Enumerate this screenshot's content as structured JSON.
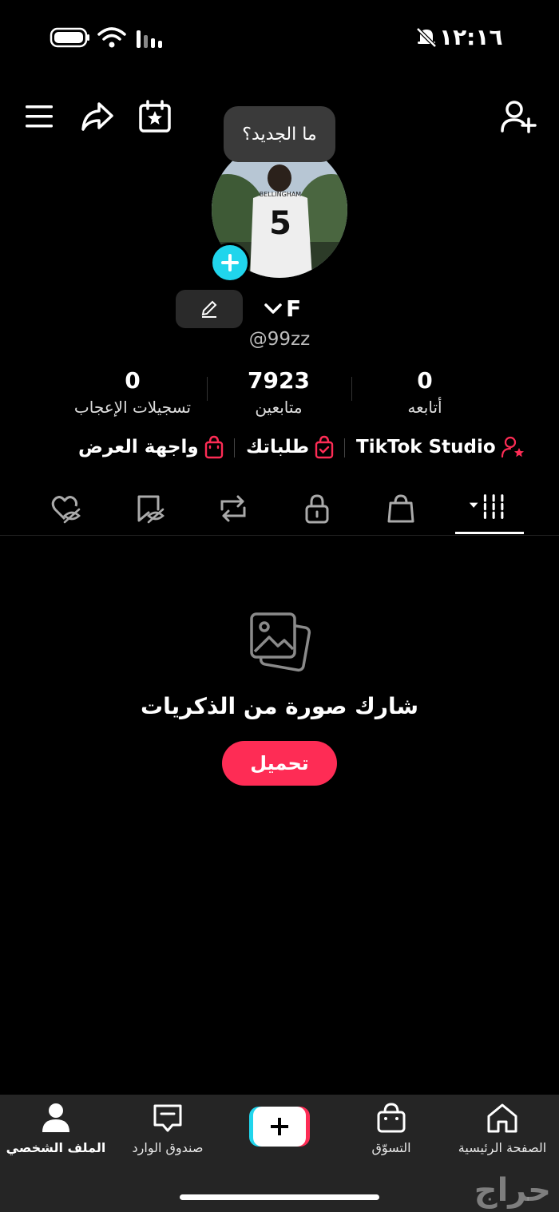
{
  "status": {
    "time": "١٢:١٦"
  },
  "tooltip": {
    "text": "ما الجديد؟"
  },
  "profile": {
    "display_name": "F",
    "username": "@99zz",
    "jersey_name": "BELLINGHAM",
    "jersey_number": "5"
  },
  "stats": [
    {
      "value": "0",
      "label": "أتابعه"
    },
    {
      "value": "7923",
      "label": "متابعين"
    },
    {
      "value": "0",
      "label": "تسجيلات الإعجاب"
    }
  ],
  "shop_links": {
    "studio": "TikTok Studio",
    "orders": "طلباتك",
    "showcase": "واجهة العرض"
  },
  "empty_state": {
    "title": "شارك صورة من الذكريات",
    "button": "تحميل"
  },
  "bottom_nav": [
    {
      "label": "الصفحة الرئيسية"
    },
    {
      "label": "التسوّق"
    },
    {
      "label": "صندوق الوارد"
    },
    {
      "label": "الملف الشخصي"
    }
  ],
  "watermark": "حراج",
  "colors": {
    "accent": "#fe2c55",
    "plus_badge": "#20d5ec",
    "nav_bg": "#252525"
  }
}
